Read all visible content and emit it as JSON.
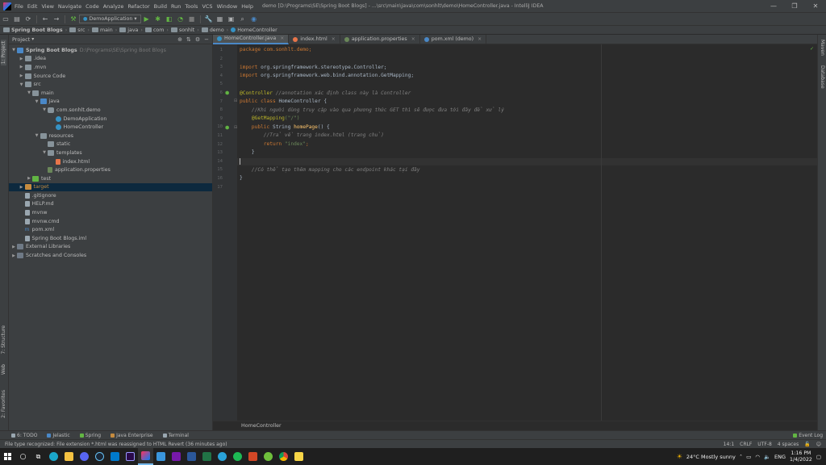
{
  "menubar": {
    "items": [
      "File",
      "Edit",
      "View",
      "Navigate",
      "Code",
      "Analyze",
      "Refactor",
      "Build",
      "Run",
      "Tools",
      "VCS",
      "Window",
      "Help"
    ],
    "window_title": "demo [D:\\Programs\\SE\\Spring Boot Blogs] - ...\\src\\main\\java\\com\\sonhlt\\demo\\HomeController.java - IntelliJ IDEA",
    "min": "—",
    "max": "❐",
    "close": "✕"
  },
  "toolbar": {
    "run_config": "DemoApplication"
  },
  "breadcrumb": [
    "Spring Boot Blogs",
    "src",
    "main",
    "java",
    "com",
    "sonhlt",
    "demo",
    "HomeController"
  ],
  "left_stripe": {
    "project": "1: Project",
    "structure": "7: Structure",
    "web": "Web",
    "favorites": "2: Favorites"
  },
  "right_stripe": {
    "maven": "Maven",
    "database": "Database"
  },
  "project_panel": {
    "title": "Project",
    "tree": [
      {
        "label": "Spring Boot Blogs",
        "hint": "D:\\Programs\\SE\\Spring Boot Blogs",
        "depth": 0,
        "arrow": "▼",
        "icon": "folder-blue",
        "bold": true
      },
      {
        "label": ".idea",
        "depth": 1,
        "arrow": "▶",
        "icon": "folder"
      },
      {
        "label": ".mvn",
        "depth": 1,
        "arrow": "▶",
        "icon": "folder"
      },
      {
        "label": "Source Code",
        "depth": 1,
        "arrow": "▶",
        "icon": "folder"
      },
      {
        "label": "src",
        "depth": 1,
        "arrow": "▼",
        "icon": "folder"
      },
      {
        "label": "main",
        "depth": 2,
        "arrow": "▼",
        "icon": "folder"
      },
      {
        "label": "java",
        "depth": 3,
        "arrow": "▼",
        "icon": "folder-blue"
      },
      {
        "label": "com.sonhlt.demo",
        "depth": 4,
        "arrow": "▼",
        "icon": "package"
      },
      {
        "label": "DemoApplication",
        "depth": 5,
        "arrow": "",
        "icon": "class"
      },
      {
        "label": "HomeController",
        "depth": 5,
        "arrow": "",
        "icon": "class"
      },
      {
        "label": "resources",
        "depth": 3,
        "arrow": "▼",
        "icon": "folder"
      },
      {
        "label": "static",
        "depth": 4,
        "arrow": "",
        "icon": "folder"
      },
      {
        "label": "templates",
        "depth": 4,
        "arrow": "▼",
        "icon": "folder"
      },
      {
        "label": "index.html",
        "depth": 5,
        "arrow": "",
        "icon": "html"
      },
      {
        "label": "application.properties",
        "depth": 4,
        "arrow": "",
        "icon": "props"
      },
      {
        "label": "test",
        "depth": 2,
        "arrow": "▶",
        "icon": "folder-green"
      },
      {
        "label": "target",
        "depth": 1,
        "arrow": "▶",
        "icon": "folder-orange",
        "selected": true
      },
      {
        "label": ".gitignore",
        "depth": 1,
        "arrow": "",
        "icon": "file"
      },
      {
        "label": "HELP.md",
        "depth": 1,
        "arrow": "",
        "icon": "file"
      },
      {
        "label": "mvnw",
        "depth": 1,
        "arrow": "",
        "icon": "file"
      },
      {
        "label": "mvnw.cmd",
        "depth": 1,
        "arrow": "",
        "icon": "file"
      },
      {
        "label": "pom.xml",
        "depth": 1,
        "arrow": "",
        "icon": "maven"
      },
      {
        "label": "Spring Boot Blogs.iml",
        "depth": 1,
        "arrow": "",
        "icon": "file"
      },
      {
        "label": "External Libraries",
        "depth": 0,
        "arrow": "▶",
        "icon": "lib"
      },
      {
        "label": "Scratches and Consoles",
        "depth": 0,
        "arrow": "▶",
        "icon": "lib"
      }
    ]
  },
  "editor_tabs": [
    {
      "label": "HomeController.java",
      "color": "#3592c4",
      "active": true
    },
    {
      "label": "index.html",
      "color": "#e8754a",
      "active": false
    },
    {
      "label": "application.properties",
      "color": "#6a8759",
      "active": false
    },
    {
      "label": "pom.xml (demo)",
      "color": "#4a88c7",
      "active": false
    }
  ],
  "line_numbers": [
    "1",
    "2",
    "3",
    "4",
    "5",
    "6",
    "7",
    "8",
    "9",
    "10",
    "11",
    "12",
    "13",
    "14",
    "15",
    "16",
    "17"
  ],
  "code": {
    "l1": "package com.sonhlt.demo;",
    "l3a": "import ",
    "l3b": "org.springframework.stereotype.Controller;",
    "l4a": "import ",
    "l4b": "org.springframework.web.bind.annotation.GetMapping;",
    "l6a": "@Controller ",
    "l6b": "//annotation xác định class này là Controller",
    "l7a": "public class ",
    "l7b": "HomeController {",
    "l8": "    //Khi người dùng truy cập vào qua phương thức GET thì sẽ được đưa tới đây để xử lý",
    "l9a": "    @GetMapping",
    "l9b": "(\"/\")",
    "l10a": "    public ",
    "l10b": "String ",
    "l10c": "homePage",
    "l10d": "() {",
    "l11": "        //Trả về trang index.html (trang chủ)",
    "l12a": "        return ",
    "l12b": "\"index\"",
    "l12c": ";",
    "l13": "    }",
    "l15": "    //Có thể tạo thêm mapping cho các endpoint khác tại đây",
    "l16": "}"
  },
  "editor_breadcrumb": "HomeController",
  "tool_tabs": [
    "6: TODO",
    "Jelastic",
    "Spring",
    "Java Enterprise",
    "Terminal"
  ],
  "event_log": "Event Log",
  "status": {
    "message": "File type recognized: File extension *.html was reassigned to HTML Revert (36 minutes ago)",
    "position": "14:1",
    "line_sep": "CRLF",
    "encoding": "UTF-8",
    "indent": "4 spaces"
  },
  "taskbar": {
    "weather": "24°C  Mostly sunny",
    "lang": "ENG",
    "time": "1:16 PM",
    "date": "1/4/2022"
  }
}
